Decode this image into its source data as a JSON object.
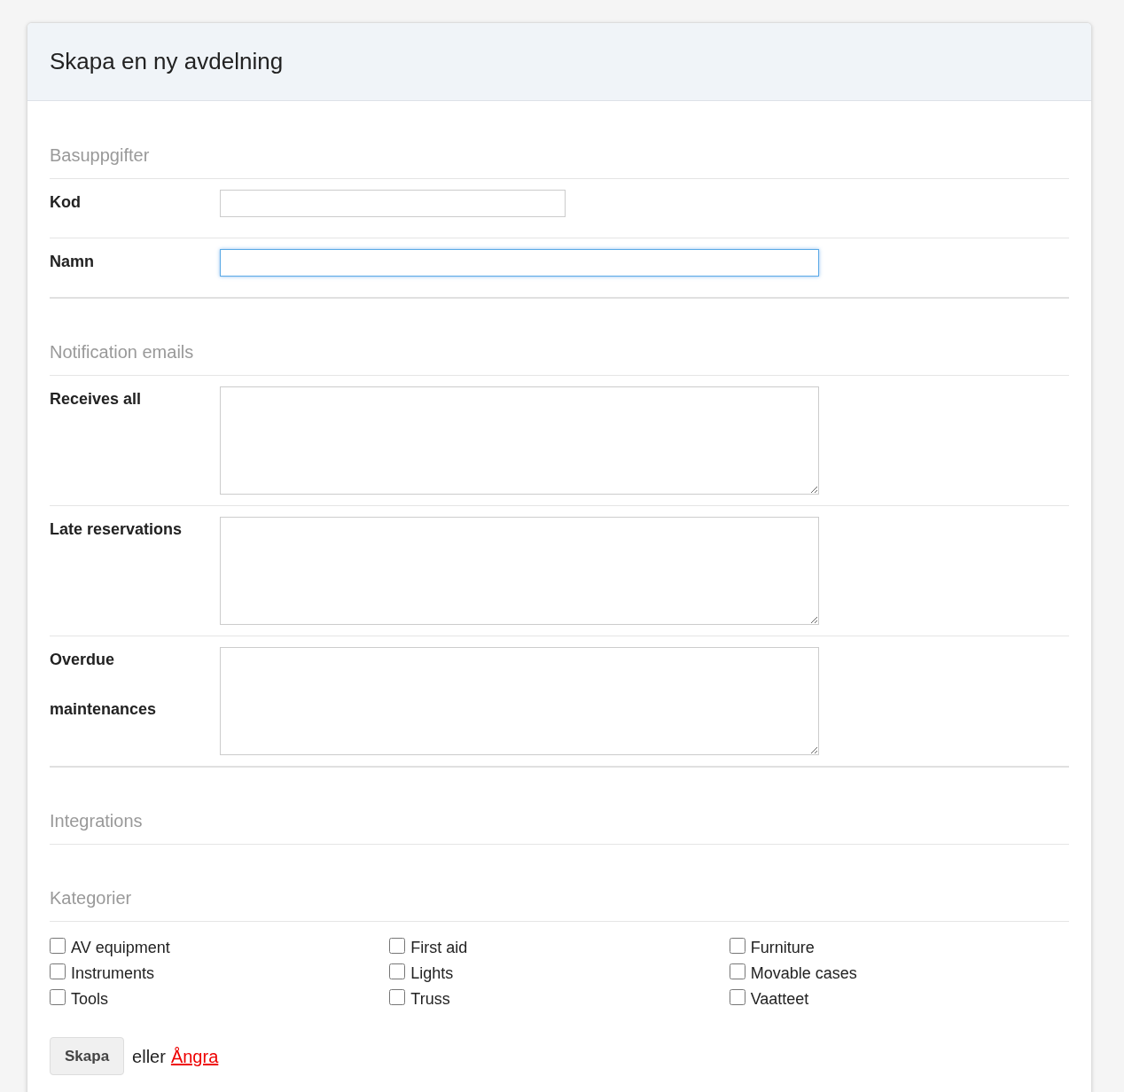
{
  "title": "Skapa en ny avdelning",
  "sections": [
    {
      "heading": "Basuppgifter",
      "kind": "fields",
      "fields": [
        {
          "label": "Kod",
          "kind": "input",
          "focused": false
        },
        {
          "label": "Namn",
          "kind": "input",
          "focused": true
        }
      ]
    },
    {
      "heading": "Notification emails",
      "kind": "fields",
      "fields": [
        {
          "label": "Receives all",
          "kind": "textarea",
          "focused": false
        },
        {
          "label": "Late reservations",
          "kind": "textarea",
          "focused": false
        },
        {
          "label": "Overdue maintenances",
          "kind": "textarea",
          "focused": false
        }
      ]
    },
    {
      "heading": "Integrations",
      "kind": "empty"
    },
    {
      "heading": "Kategorier",
      "kind": "checkboxes",
      "items": [
        {
          "label": "AV equipment",
          "checked": false
        },
        {
          "label": "First aid",
          "checked": false
        },
        {
          "label": "Furniture",
          "checked": false
        },
        {
          "label": "Instruments",
          "checked": false
        },
        {
          "label": "Lights",
          "checked": false
        },
        {
          "label": "Movable cases",
          "checked": false
        },
        {
          "label": "Tools",
          "checked": false
        },
        {
          "label": "Truss",
          "checked": false
        },
        {
          "label": "Vaatteet",
          "checked": false
        }
      ]
    }
  ],
  "actions": {
    "submit": "Skapa",
    "separator": "eller",
    "cancel": "Ångra"
  }
}
